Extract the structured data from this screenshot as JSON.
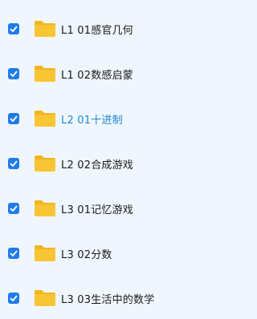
{
  "file_list": {
    "items": [
      {
        "name": "L1 01感官几何",
        "checked": true,
        "highlighted": false,
        "icon": "folder-icon"
      },
      {
        "name": "L1 02数感启蒙",
        "checked": true,
        "highlighted": false,
        "icon": "folder-icon"
      },
      {
        "name": "L2 01十进制",
        "checked": true,
        "highlighted": true,
        "icon": "folder-icon"
      },
      {
        "name": "L2 02合成游戏",
        "checked": true,
        "highlighted": false,
        "icon": "folder-icon"
      },
      {
        "name": "L3 01记忆游戏",
        "checked": true,
        "highlighted": false,
        "icon": "folder-icon"
      },
      {
        "name": "L3 02分数",
        "checked": true,
        "highlighted": false,
        "icon": "folder-icon"
      },
      {
        "name": "L3 03生活中的数学",
        "checked": true,
        "highlighted": false,
        "icon": "folder-icon"
      }
    ]
  },
  "colors": {
    "background": "#f0f6fd",
    "checkbox": "#1e7ce8",
    "folder_body": "#f8c535",
    "folder_tab": "#f1b51f",
    "text": "#1a1a1a",
    "highlight_text": "#1e88d6"
  }
}
